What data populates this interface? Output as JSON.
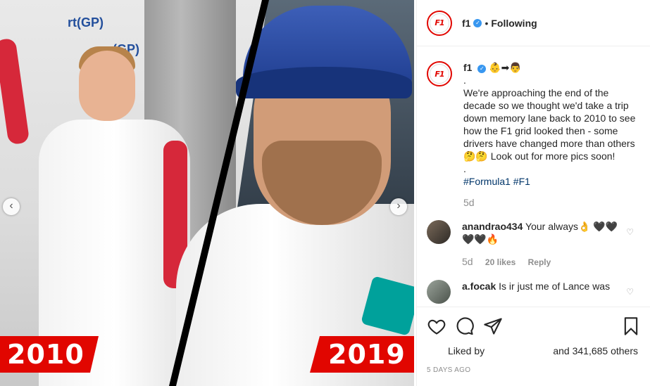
{
  "photo": {
    "badge_left": "2010",
    "badge_right": "2019",
    "prev_arrow": "‹",
    "next_arrow": "›"
  },
  "header": {
    "username": "f1",
    "separator": "•",
    "follow_status": "Following"
  },
  "caption": {
    "username": "f1",
    "emojis": "👶➡👨",
    "dot1": ".",
    "text": "We're approaching the end of the decade so we thought we'd take a trip down memory lane back to 2010 to see how the F1 grid looked then - some drivers have changed more than others 🤔🤔 Look out for more pics soon!",
    "dot2": ".",
    "hashtags": "#Formula1 #F1",
    "age": "5d"
  },
  "comments": [
    {
      "username": "anandrao434",
      "text": "Your always👌 🖤🖤 🖤🖤🔥",
      "age": "5d",
      "likes": "20 likes",
      "reply": "Reply"
    },
    {
      "username": "a.focak",
      "text": "Is ir just me of Lance was"
    }
  ],
  "actions": {
    "liked_by": "Liked by",
    "like_count": "and 341,685 others",
    "timestamp": "5 DAYS AGO"
  },
  "colors": {
    "brand_red": "#e10600",
    "verified_blue": "#3897f0",
    "hashtag_blue": "#003569",
    "meta_gray": "#8e8e8e"
  }
}
